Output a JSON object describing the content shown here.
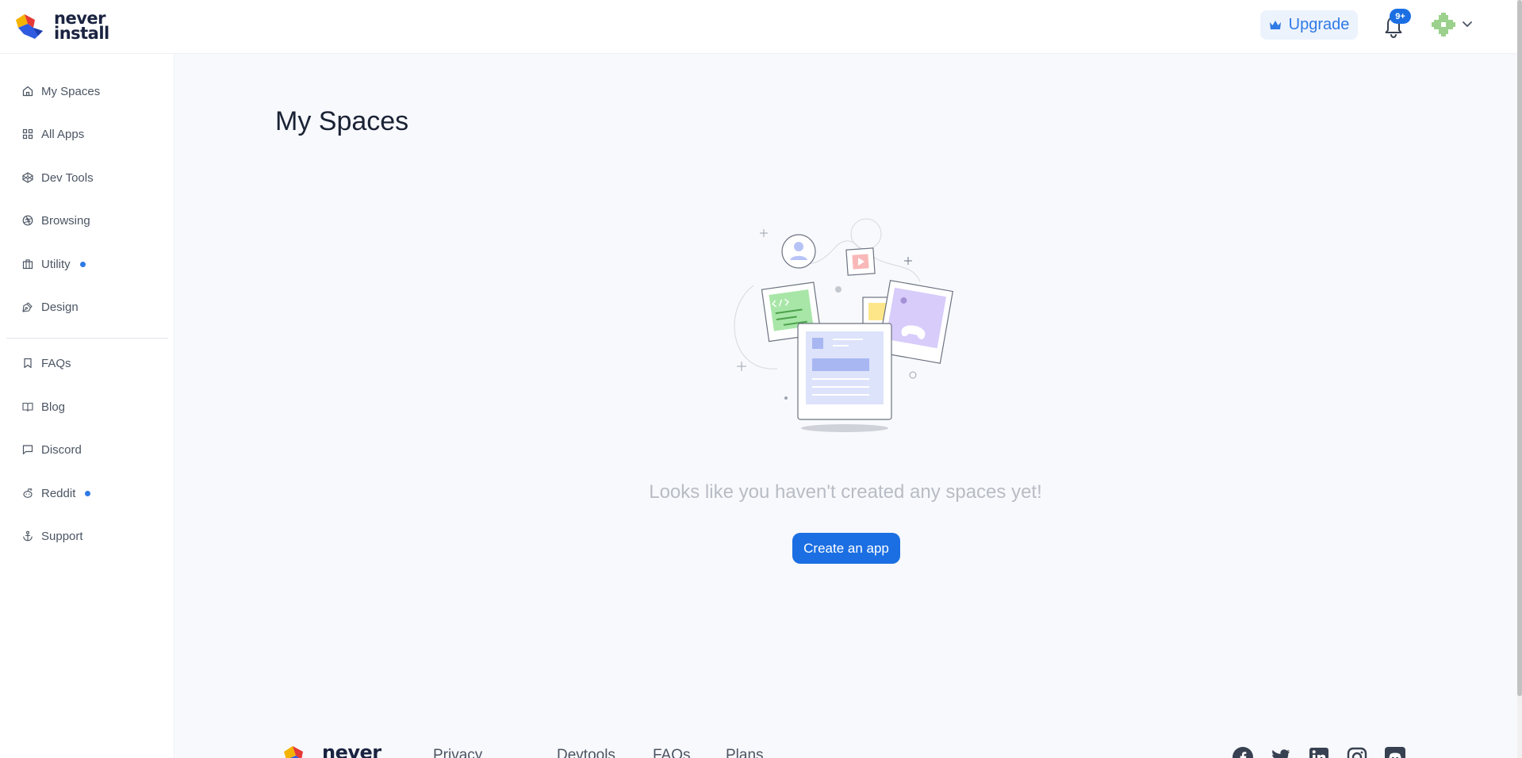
{
  "brand": {
    "line1": "never",
    "line2": "install"
  },
  "header": {
    "upgrade_label": "Upgrade",
    "notification_badge": "9+"
  },
  "sidebar": {
    "items": [
      {
        "label": "My Spaces",
        "icon": "home-icon"
      },
      {
        "label": "All Apps",
        "icon": "grid-icon"
      },
      {
        "label": "Dev Tools",
        "icon": "codepen-icon"
      },
      {
        "label": "Browsing",
        "icon": "aperture-icon"
      },
      {
        "label": "Utility",
        "icon": "briefcase-icon",
        "dot": true
      },
      {
        "label": "Design",
        "icon": "pen-tool-icon"
      }
    ],
    "secondary_items": [
      {
        "label": "FAQs",
        "icon": "bookmark-icon"
      },
      {
        "label": "Blog",
        "icon": "book-open-icon"
      },
      {
        "label": "Discord",
        "icon": "message-square-icon"
      },
      {
        "label": "Reddit",
        "icon": "reddit-icon",
        "dot": true
      },
      {
        "label": "Support",
        "icon": "anchor-icon"
      }
    ]
  },
  "main": {
    "title": "My Spaces",
    "empty_message": "Looks like you haven't created any spaces yet!",
    "create_button": "Create an app"
  },
  "footer": {
    "brand": "never",
    "links": [
      "Privacy",
      "Devtools",
      "FAQs",
      "Plans"
    ],
    "social_icons": [
      "facebook-icon",
      "twitter-icon",
      "linkedin-icon",
      "instagram-icon",
      "discord-icon"
    ]
  },
  "colors": {
    "accent": "#1b6fe3",
    "upgrade_bg": "#edf3fd",
    "background": "#f8f9fc",
    "dot": "#2f7ae5"
  }
}
